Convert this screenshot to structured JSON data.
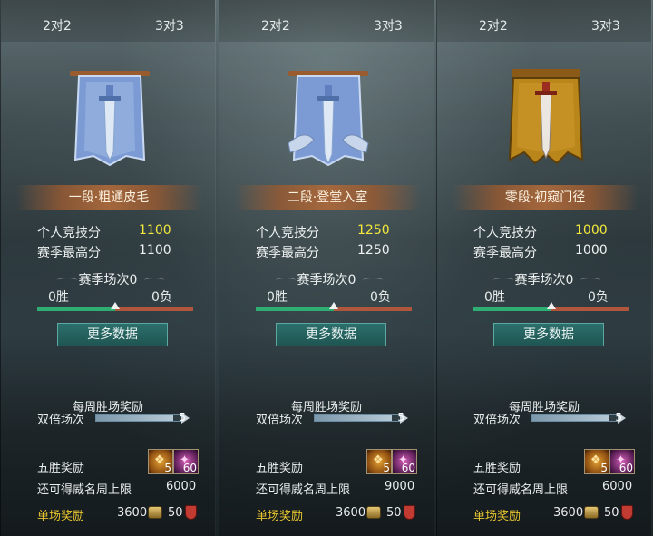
{
  "panels": [
    {
      "tabs": [
        "2对2",
        "3对3"
      ],
      "rank": "一段·粗通皮毛",
      "stats": [
        {
          "label": "个人竞技分",
          "value": "1100",
          "highlight": true
        },
        {
          "label": "赛季最高分",
          "value": "1100",
          "highlight": false
        }
      ],
      "season": {
        "title": "赛季场次0",
        "wins": "0胜",
        "losses": "0负",
        "win_ratio": 0.5
      },
      "more_button": "更多数据",
      "weekly": {
        "title": "每周胜场奖励",
        "double_label": "双倍场次",
        "double_value": "5",
        "double_fill": 0.9
      },
      "five_win": {
        "label": "五胜奖励",
        "item1_count": "5",
        "item2_count": "60"
      },
      "cap": {
        "label": "还可得威名周上限",
        "value": "6000"
      },
      "single": {
        "label": "单场奖励",
        "coins": "3600",
        "honor": "50"
      },
      "emblem": {
        "style": "blue-banner",
        "color": "#7c9bd4"
      }
    },
    {
      "tabs": [
        "2对2",
        "3对3"
      ],
      "rank": "二段·登堂入室",
      "stats": [
        {
          "label": "个人竞技分",
          "value": "1250",
          "highlight": true
        },
        {
          "label": "赛季最高分",
          "value": "1250",
          "highlight": false
        }
      ],
      "season": {
        "title": "赛季场次0",
        "wins": "0胜",
        "losses": "0负",
        "win_ratio": 0.5
      },
      "more_button": "更多数据",
      "weekly": {
        "title": "每周胜场奖励",
        "double_label": "双倍场次",
        "double_value": "5",
        "double_fill": 0.9
      },
      "five_win": {
        "label": "五胜奖励",
        "item1_count": "5",
        "item2_count": "60"
      },
      "cap": {
        "label": "还可得威名周上限",
        "value": "9000"
      },
      "single": {
        "label": "单场奖励",
        "coins": "3600",
        "honor": "50"
      },
      "emblem": {
        "style": "blue-banner-winged",
        "color": "#7c9bd4"
      }
    },
    {
      "tabs": [
        "2对2",
        "3对3"
      ],
      "rank": "零段·初窥门径",
      "stats": [
        {
          "label": "个人竞技分",
          "value": "1000",
          "highlight": true
        },
        {
          "label": "赛季最高分",
          "value": "1000",
          "highlight": false
        }
      ],
      "season": {
        "title": "赛季场次0",
        "wins": "0胜",
        "losses": "0负",
        "win_ratio": 0.5
      },
      "more_button": "更多数据",
      "weekly": {
        "title": "每周胜场奖励",
        "double_label": "双倍场次",
        "double_value": "5",
        "double_fill": 0.9
      },
      "five_win": {
        "label": "五胜奖励",
        "item1_count": "5",
        "item2_count": "60"
      },
      "cap": {
        "label": "还可得威名周上限",
        "value": "6000"
      },
      "single": {
        "label": "单场奖励",
        "coins": "3600",
        "honor": "50"
      },
      "emblem": {
        "style": "gold-banner",
        "color": "#b9861c"
      }
    }
  ],
  "colors": {
    "highlight_score": "#f3e93c",
    "win_bar": "#2eae73",
    "loss_bar": "#b0563d",
    "single_label": "#e6c62f"
  }
}
